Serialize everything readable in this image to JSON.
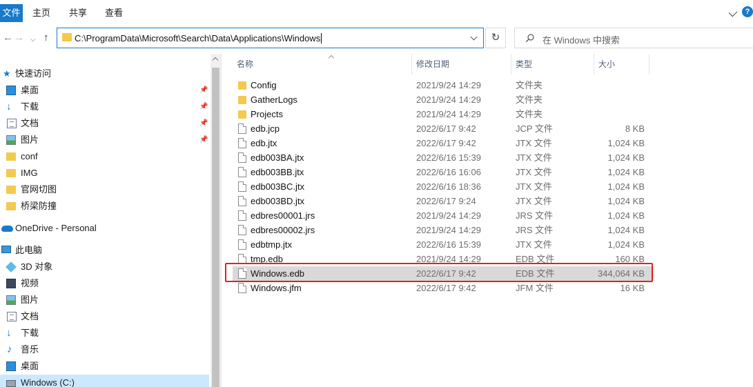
{
  "ribbon": {
    "tabs": [
      "文件",
      "主页",
      "共享",
      "查看"
    ],
    "help": "?"
  },
  "address": {
    "path": "C:\\ProgramData\\Microsoft\\Search\\Data\\Applications\\Windows"
  },
  "search": {
    "placeholder": "在 Windows 中搜索"
  },
  "sidebar": {
    "items": [
      {
        "label": "快速访问",
        "icon": "star-icon"
      },
      {
        "label": "桌面",
        "icon": "desktop-icon"
      },
      {
        "label": "下载",
        "icon": "download-icon"
      },
      {
        "label": "文档",
        "icon": "document-icon"
      },
      {
        "label": "图片",
        "icon": "picture-icon"
      },
      {
        "label": "conf",
        "icon": "folder-icon"
      },
      {
        "label": "IMG",
        "icon": "folder-icon"
      },
      {
        "label": "官网切图",
        "icon": "folder-icon"
      },
      {
        "label": "桥梁防撞",
        "icon": "folder-icon"
      },
      {
        "label": "OneDrive - Personal",
        "icon": "cloud-icon"
      },
      {
        "label": "此电脑",
        "icon": "computer-icon"
      },
      {
        "label": "3D 对象",
        "icon": "3d-objects-icon"
      },
      {
        "label": "视频",
        "icon": "video-icon"
      },
      {
        "label": "图片",
        "icon": "picture-icon"
      },
      {
        "label": "文档",
        "icon": "document-icon"
      },
      {
        "label": "下载",
        "icon": "download-icon"
      },
      {
        "label": "音乐",
        "icon": "music-icon"
      },
      {
        "label": "桌面",
        "icon": "desktop-icon"
      },
      {
        "label": "Windows (C:)",
        "icon": "drive-icon"
      }
    ]
  },
  "columns": {
    "name": "名称",
    "date": "修改日期",
    "type": "类型",
    "size": "大小"
  },
  "files": [
    {
      "name": "Config",
      "date": "2021/9/24 14:29",
      "type": "文件夹",
      "size": "",
      "kind": "folder"
    },
    {
      "name": "GatherLogs",
      "date": "2021/9/24 14:29",
      "type": "文件夹",
      "size": "",
      "kind": "folder"
    },
    {
      "name": "Projects",
      "date": "2021/9/24 14:29",
      "type": "文件夹",
      "size": "",
      "kind": "folder"
    },
    {
      "name": "edb.jcp",
      "date": "2022/6/17 9:42",
      "type": "JCP 文件",
      "size": "8 KB",
      "kind": "file"
    },
    {
      "name": "edb.jtx",
      "date": "2022/6/17 9:42",
      "type": "JTX 文件",
      "size": "1,024 KB",
      "kind": "file"
    },
    {
      "name": "edb003BA.jtx",
      "date": "2022/6/16 15:39",
      "type": "JTX 文件",
      "size": "1,024 KB",
      "kind": "file"
    },
    {
      "name": "edb003BB.jtx",
      "date": "2022/6/16 16:06",
      "type": "JTX 文件",
      "size": "1,024 KB",
      "kind": "file"
    },
    {
      "name": "edb003BC.jtx",
      "date": "2022/6/16 18:36",
      "type": "JTX 文件",
      "size": "1,024 KB",
      "kind": "file"
    },
    {
      "name": "edb003BD.jtx",
      "date": "2022/6/17 9:24",
      "type": "JTX 文件",
      "size": "1,024 KB",
      "kind": "file"
    },
    {
      "name": "edbres00001.jrs",
      "date": "2021/9/24 14:29",
      "type": "JRS 文件",
      "size": "1,024 KB",
      "kind": "file"
    },
    {
      "name": "edbres00002.jrs",
      "date": "2021/9/24 14:29",
      "type": "JRS 文件",
      "size": "1,024 KB",
      "kind": "file"
    },
    {
      "name": "edbtmp.jtx",
      "date": "2022/6/16 15:39",
      "type": "JTX 文件",
      "size": "1,024 KB",
      "kind": "file"
    },
    {
      "name": "tmp.edb",
      "date": "2021/9/24 14:29",
      "type": "EDB 文件",
      "size": "160 KB",
      "kind": "file"
    },
    {
      "name": "Windows.edb",
      "date": "2022/6/17 9:42",
      "type": "EDB 文件",
      "size": "344,064 KB",
      "kind": "file",
      "selected": true
    },
    {
      "name": "Windows.jfm",
      "date": "2022/6/17 9:42",
      "type": "JFM 文件",
      "size": "16 KB",
      "kind": "file"
    }
  ],
  "colors": {
    "accent": "#1979ca",
    "highlight_border": "#e02020",
    "selected_row": "#d9d9d9",
    "folder": "#f3c94e"
  }
}
